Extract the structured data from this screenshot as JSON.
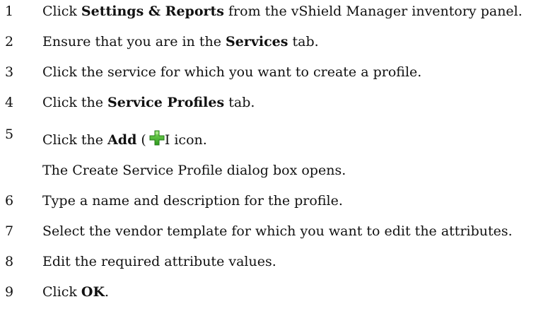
{
  "steps": [
    {
      "num": "1",
      "pre": "Click ",
      "bold": "Settings & Reports",
      "post": " from the vShield Manager inventory panel."
    },
    {
      "num": "2",
      "pre": "Ensure that you are in the ",
      "bold": "Services",
      "post": " tab."
    },
    {
      "num": "3",
      "text": "Click the service for which you want to create a profile."
    },
    {
      "num": "4",
      "pre": "Click the ",
      "bold": "Service Profiles",
      "post": " tab."
    },
    {
      "num": "5",
      "pre": "Click the ",
      "bold": "Add",
      "mid": " (",
      "post": "I icon.",
      "icon": "add-plus-icon"
    },
    {
      "text": "The Create Service Profile dialog box opens."
    },
    {
      "num": "6",
      "text": "Type a name and description for the profile."
    },
    {
      "num": "7",
      "text": "Select the vendor template for which you want to edit the attributes."
    },
    {
      "num": "8",
      "text": "Edit the required attribute values."
    },
    {
      "num": "9",
      "pre": "Click ",
      "bold": "OK",
      "post": "."
    }
  ],
  "colors": {
    "text": "#111111",
    "icon_green": "#3fae2a"
  }
}
